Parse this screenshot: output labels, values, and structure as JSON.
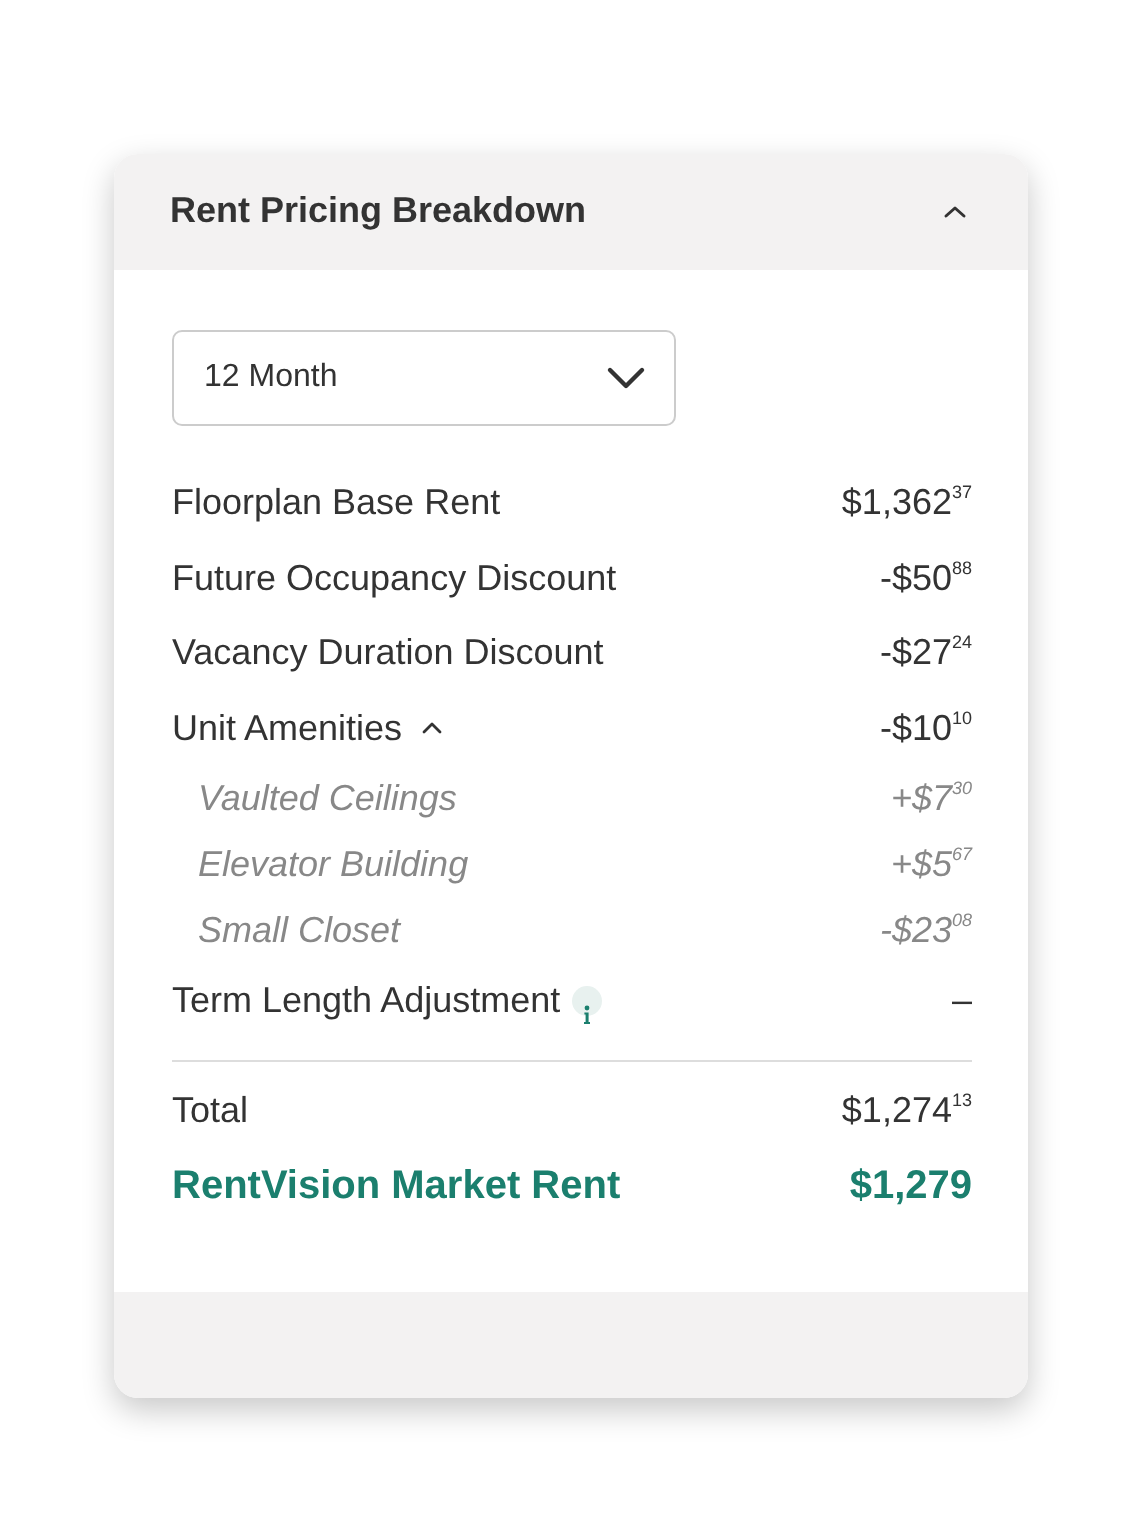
{
  "panel": {
    "title": "Rent Pricing Breakdown",
    "expanded": true
  },
  "term_select": {
    "value": "12 Month"
  },
  "lines": [
    {
      "kind": "line",
      "label": "Floorplan Base Rent",
      "amount": "$1,362$^{37}$"
    },
    {
      "kind": "line",
      "label": "Future Occupancy Discount",
      "amount": "-$50$^{88}$"
    },
    {
      "kind": "line",
      "label": "Vacancy Duration Discount",
      "amount": "-$27$^{24}$"
    },
    {
      "kind": "group",
      "label": "Unit Amenities",
      "amount": "-$10$^{10}$",
      "expanded": true,
      "children": [
        {
          "label": "Vaulted Ceilings",
          "amount": "+$7$^{30}$"
        },
        {
          "label": "Elevator Building",
          "amount": "+$5$^{67}$"
        },
        {
          "label": "Small Closet",
          "amount": "-$23$^{08}$"
        }
      ]
    },
    {
      "kind": "line",
      "label": "Term Length Adjustment",
      "amount": "–",
      "info": true
    }
  ],
  "total": {
    "label": "Total",
    "amount": "$1,274$^{13}$"
  },
  "market_rent": {
    "label": "RentVision Market Rent",
    "amount": "$1,279"
  }
}
